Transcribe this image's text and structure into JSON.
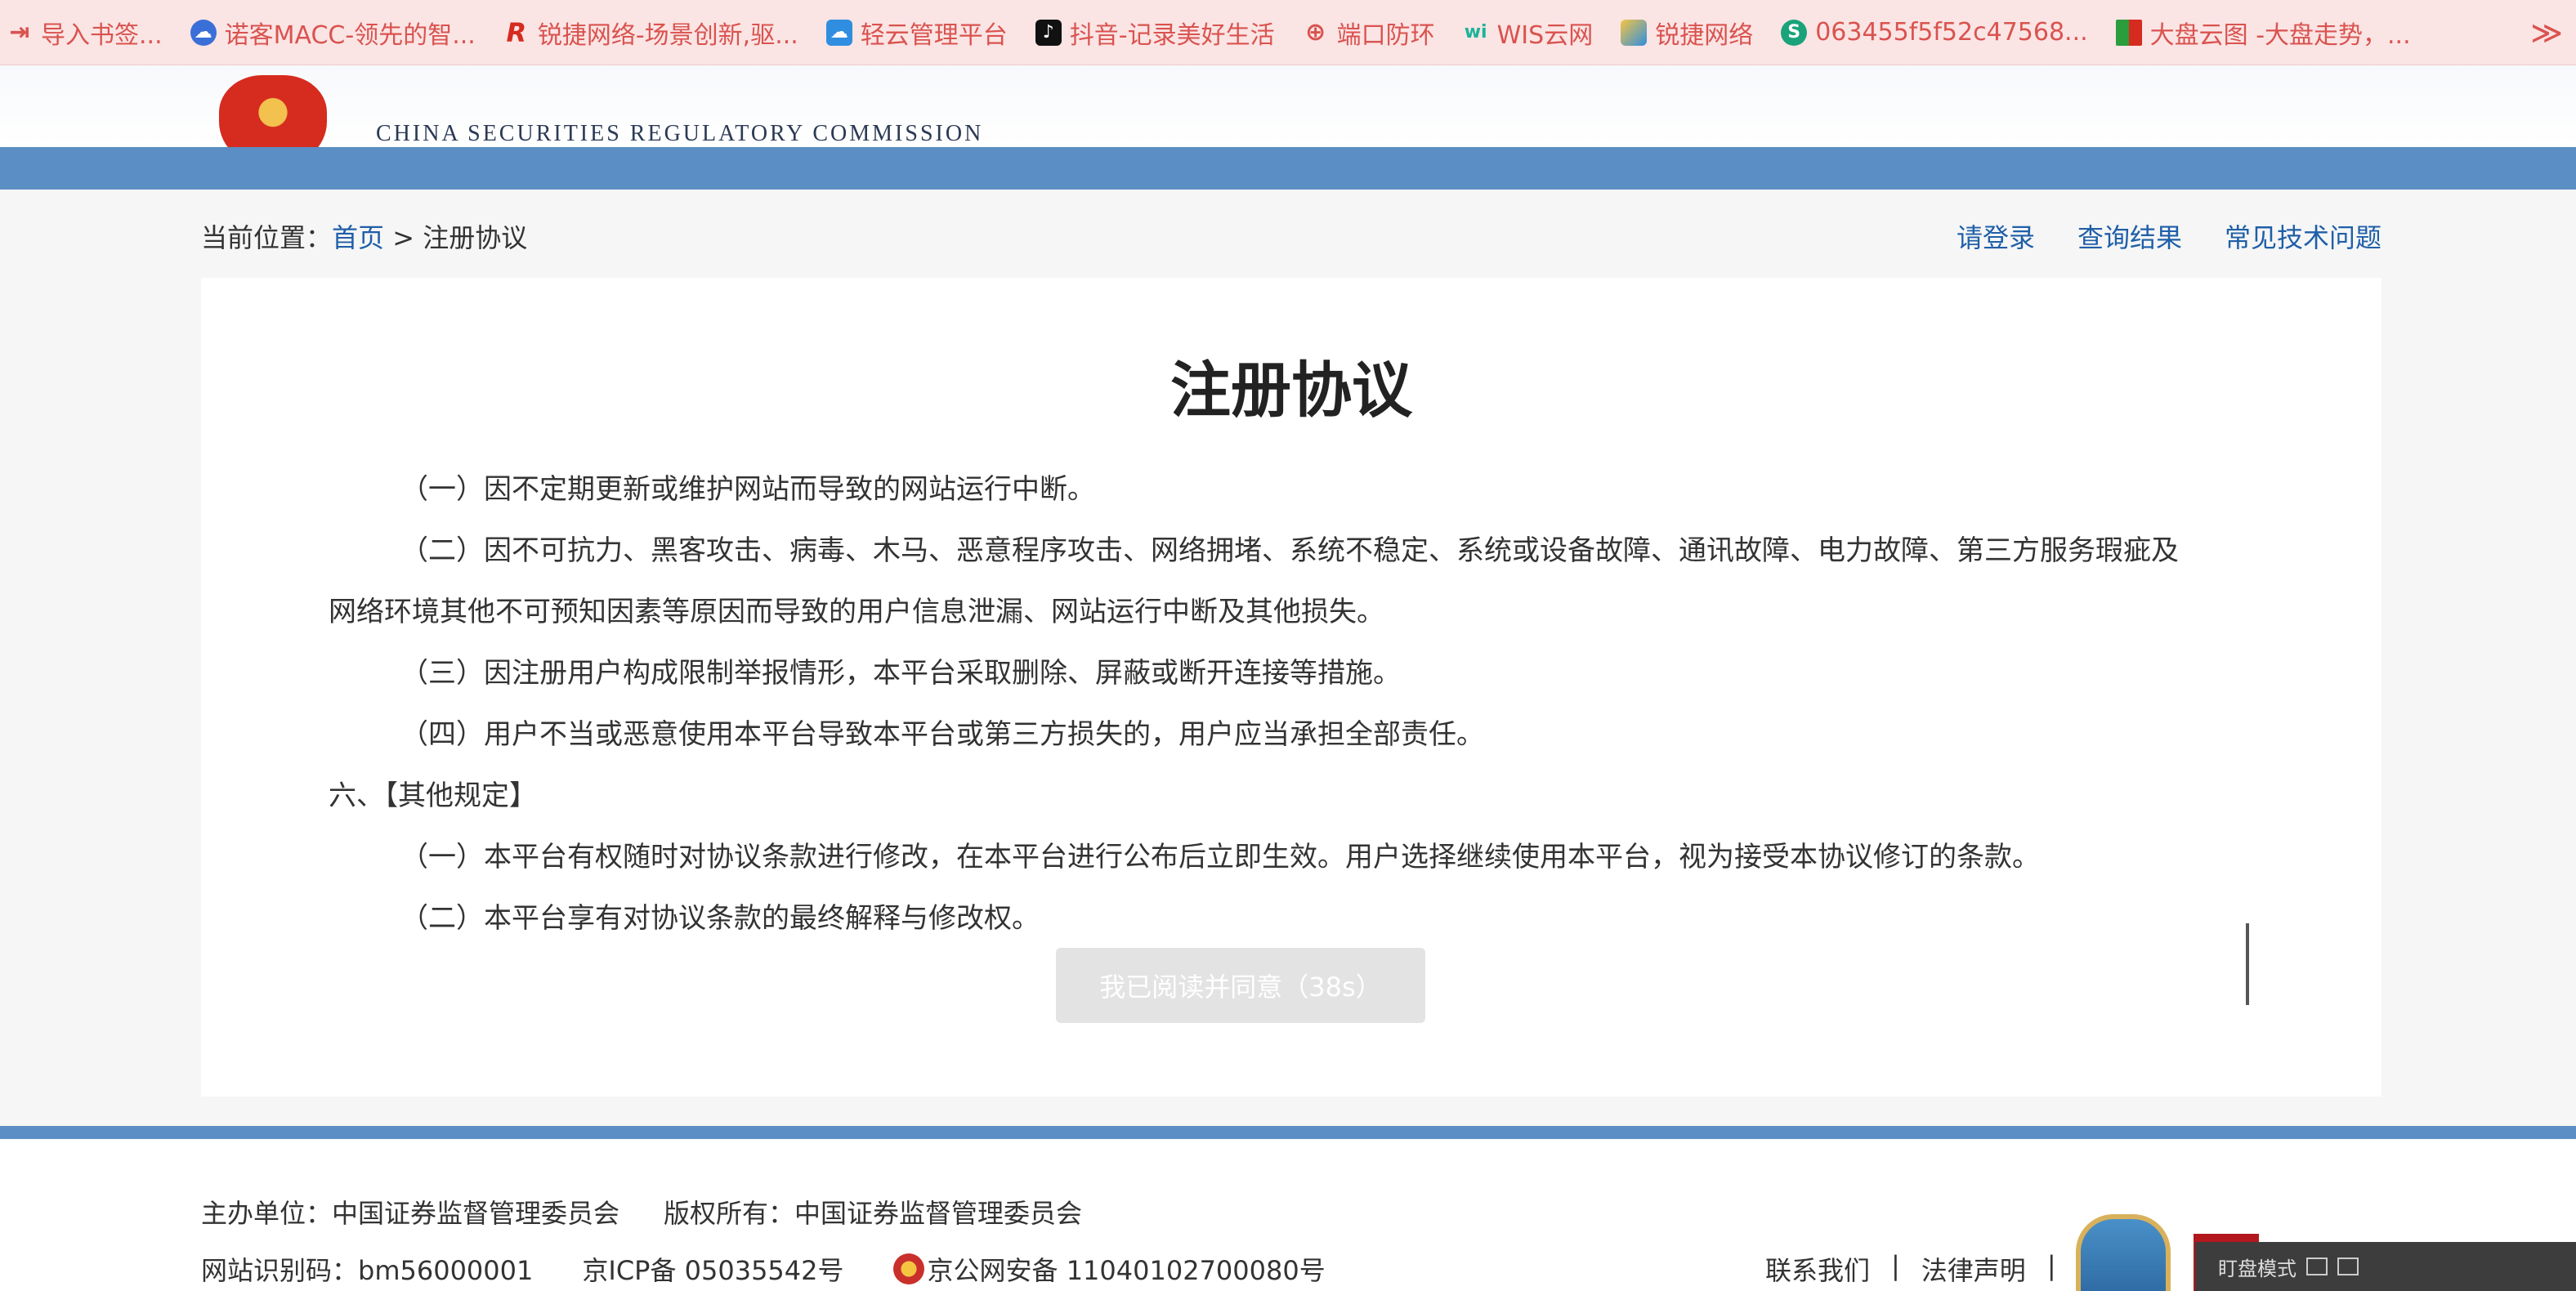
{
  "bookmarks": [
    {
      "label": "导入书签...",
      "icon": "import-icon",
      "color": "#d9534f"
    },
    {
      "label": "诺客MACC-领先的智...",
      "icon": "cloud-icon",
      "color": "#3b6fd8"
    },
    {
      "label": "锐捷网络-场景创新,驱...",
      "icon": "ruijie-logo",
      "color": "#d62b1f"
    },
    {
      "label": "轻云管理平台",
      "icon": "cloud-icon",
      "color": "#2f8ee0"
    },
    {
      "label": "抖音-记录美好生活",
      "icon": "tiktok-icon",
      "color": "#111111"
    },
    {
      "label": "端口防环",
      "icon": "globe-icon",
      "color": "#d9534f"
    },
    {
      "label": "WIS云网",
      "icon": "wis-icon",
      "color": "#1bb39a"
    },
    {
      "label": "锐捷网络",
      "icon": "ruijie-icon",
      "color": "#2f8ee0"
    },
    {
      "label": "063455f5f52c47568...",
      "icon": "s-icon",
      "color": "#1aa37a"
    },
    {
      "label": "大盘云图 -大盘走势，...",
      "icon": "chart-icon",
      "color": "#2a9d3c"
    }
  ],
  "header": {
    "org_en": "CHINA SECURITIES REGULATORY COMMISSION"
  },
  "breadcrumb": {
    "prefix": "当前位置：",
    "home": "首页",
    "sep": " > ",
    "current": "注册协议"
  },
  "top_links": [
    "请登录",
    "查询结果",
    "常见技术问题"
  ],
  "agreement": {
    "title": "注册协议",
    "paragraphs": [
      "（一）因不定期更新或维护网站而导致的网站运行中断。",
      "（二）因不可抗力、黑客攻击、病毒、木马、恶意程序攻击、网络拥堵、系统不稳定、系统或设备故障、通讯故障、电力故障、第三方服务瑕疵及",
      "网络环境其他不可预知因素等原因而导致的用户信息泄漏、网站运行中断及其他损失。",
      "（三）因注册用户构成限制举报情形，本平台采取删除、屏蔽或断开连接等措施。",
      "（四）用户不当或恶意使用本平台导致本平台或第三方损失的，用户应当承担全部责任。",
      "六、【其他规定】",
      "（一）本平台有权随时对协议条款进行修改，在本平台进行公布后立即生效。用户选择继续使用本平台，视为接受本协议修订的条款。",
      "（二）本平台享有对协议条款的最终解释与修改权。"
    ],
    "agree_button": "我已阅读并同意（38s）"
  },
  "footer": {
    "sponsor": "主办单位：中国证券监督管理委员会",
    "copyright": "版权所有：中国证券监督管理委员会",
    "site_id": "网站识别码：bm56000001",
    "icp": "京ICP备 05035542号",
    "police": "京公网安备 11040102700080号",
    "contact": "联系我们",
    "legal": "法律声明",
    "divider": "|"
  },
  "read_mode": "盯盘模式"
}
